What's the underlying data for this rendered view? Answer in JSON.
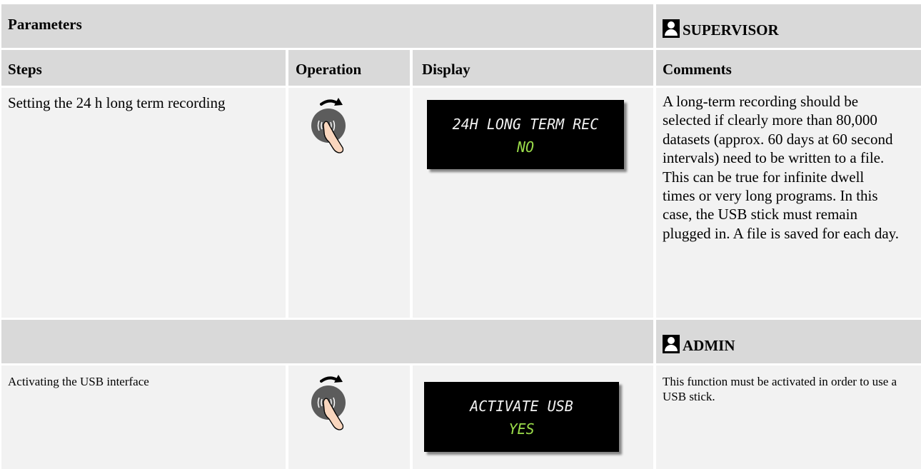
{
  "section1": {
    "title": "Parameters",
    "role": "SUPERVISOR"
  },
  "columns": {
    "steps": "Steps",
    "operation": "Operation",
    "display": "Display",
    "comments": "Comments"
  },
  "row1": {
    "step": "Setting the 24 h long term recording",
    "operation_icon": "rotate-knob-icon",
    "display_line1": "24H LONG TERM REC",
    "display_line2": "NO",
    "comment": "A long-term recording should be selected if clearly more than 80,000 datasets (approx. 60 days at 60 second intervals) need to be written to a file. This can be true for infinite dwell times or very long programs. In this case, the USB stick must remain plugged in. A file is saved for each day."
  },
  "section2": {
    "role": "ADMIN"
  },
  "row2": {
    "step": "Activating the USB interface",
    "operation_icon": "rotate-knob-icon",
    "display_line1": "ACTIVATE USB",
    "display_line2": "YES",
    "comment": "This function must be activated in order to use a USB stick."
  },
  "colors": {
    "header_bg": "#d9d9d9",
    "body_bg": "#f2f2f2",
    "display_bg": "#000000",
    "display_text": "#f2f2f2",
    "display_value": "#9bdc4a"
  }
}
